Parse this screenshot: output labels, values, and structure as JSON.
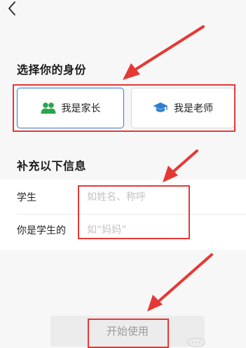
{
  "header": {
    "back_icon": "chevron-left-icon"
  },
  "identity": {
    "title": "选择你的身份",
    "options": [
      {
        "label": "我是家长",
        "icon": "parents-icon",
        "icon_color": "#2aa44f",
        "selected": true
      },
      {
        "label": "我是老师",
        "icon": "graduation-cap-icon",
        "icon_color": "#2f7fcf",
        "selected": false
      }
    ]
  },
  "info": {
    "title": "补充以下信息",
    "fields": [
      {
        "label": "学生",
        "placeholder": "如姓名、称呼",
        "value": ""
      },
      {
        "label": "你是学生的",
        "placeholder": "如“妈妈”",
        "value": ""
      }
    ]
  },
  "start_button": {
    "label": "开始使用"
  },
  "colors": {
    "accent": "#2f7fcf",
    "annotation": "#e53935",
    "background": "#f7f7f7",
    "button_disabled": "#ececec"
  }
}
